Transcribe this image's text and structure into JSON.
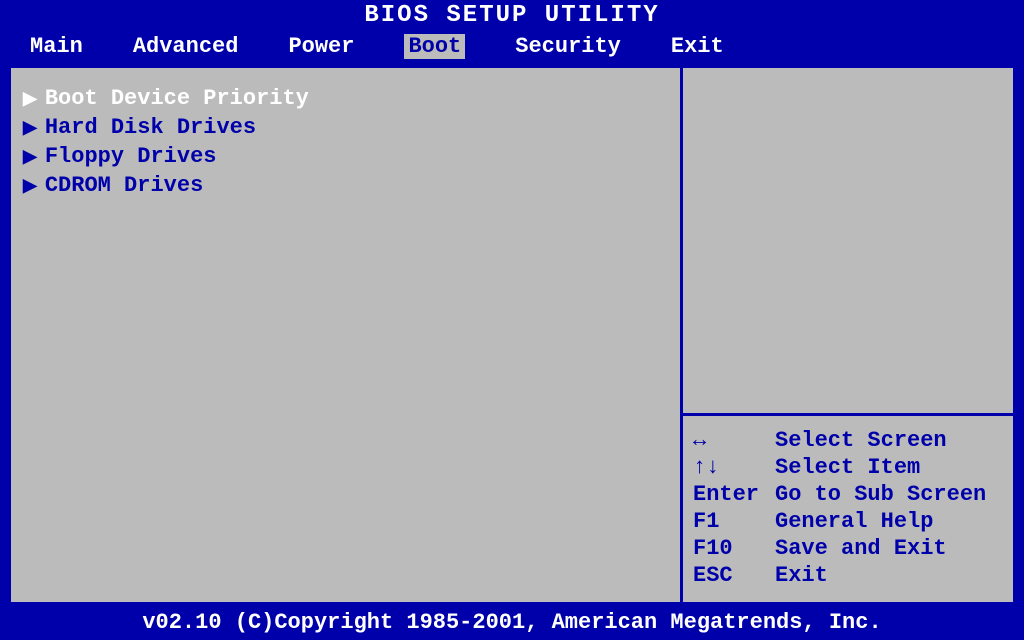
{
  "title": "BIOS SETUP UTILITY",
  "menu": {
    "items": [
      {
        "label": "Main",
        "selected": false
      },
      {
        "label": "Advanced",
        "selected": false
      },
      {
        "label": "Power",
        "selected": false
      },
      {
        "label": "Boot",
        "selected": true
      },
      {
        "label": "Security",
        "selected": false
      },
      {
        "label": "Exit",
        "selected": false
      }
    ]
  },
  "options": [
    {
      "label": "Boot Device Priority",
      "highlighted": true
    },
    {
      "label": "Hard Disk Drives",
      "highlighted": false
    },
    {
      "label": "Floppy Drives",
      "highlighted": false
    },
    {
      "label": "CDROM Drives",
      "highlighted": false
    }
  ],
  "help": [
    {
      "key": "↔",
      "desc": "Select Screen"
    },
    {
      "key": "↑↓",
      "desc": "Select Item"
    },
    {
      "key": "Enter",
      "desc": "Go to Sub Screen"
    },
    {
      "key": "F1",
      "desc": "General Help"
    },
    {
      "key": "F10",
      "desc": "Save and Exit"
    },
    {
      "key": "ESC",
      "desc": "Exit"
    }
  ],
  "footer": "v02.10 (C)Copyright 1985-2001, American Megatrends, Inc."
}
